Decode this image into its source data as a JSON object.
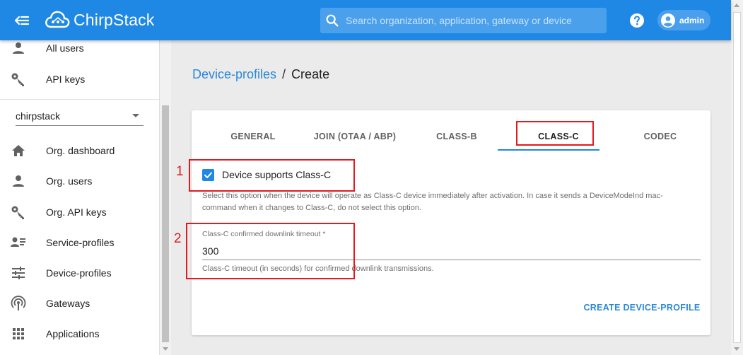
{
  "header": {
    "brand": "ChirpStack",
    "search_placeholder": "Search organization, application, gateway or device",
    "user": "admin"
  },
  "sidebar": {
    "top_items": [
      {
        "label": "All users",
        "icon": "person-icon"
      },
      {
        "label": "API keys",
        "icon": "key-icon"
      }
    ],
    "org_select": "chirpstack",
    "org_items": [
      {
        "label": "Org. dashboard",
        "icon": "home-icon"
      },
      {
        "label": "Org. users",
        "icon": "person-icon"
      },
      {
        "label": "Org. API keys",
        "icon": "key-icon"
      },
      {
        "label": "Service-profiles",
        "icon": "account-details-icon"
      },
      {
        "label": "Device-profiles",
        "icon": "tune-icon"
      },
      {
        "label": "Gateways",
        "icon": "access-point-icon"
      },
      {
        "label": "Applications",
        "icon": "apps-icon"
      }
    ]
  },
  "breadcrumb": {
    "link": "Device-profiles",
    "separator": "/",
    "current": "Create"
  },
  "tabs": [
    "GENERAL",
    "JOIN (OTAA / ABP)",
    "CLASS-B",
    "CLASS-C",
    "CODEC"
  ],
  "active_tab": "CLASS-C",
  "form": {
    "checkbox_label": "Device supports Class-C",
    "checkbox_checked": true,
    "checkbox_help": "Select this option when the device will operate as Class-C device immediately after activation. In case it sends a DeviceModeInd mac-command when it changes to Class-C, do not select this option.",
    "timeout_label": "Class-C confirmed downlink timeout *",
    "timeout_value": "300",
    "timeout_help": "Class-C timeout (in seconds) for confirmed downlink transmissions.",
    "submit": "CREATE DEVICE-PROFILE"
  },
  "annotations": {
    "one": "1",
    "two": "2",
    "color": "#e4191f"
  },
  "colors": {
    "primary": "#1f88e5",
    "link": "#2b88d8"
  }
}
